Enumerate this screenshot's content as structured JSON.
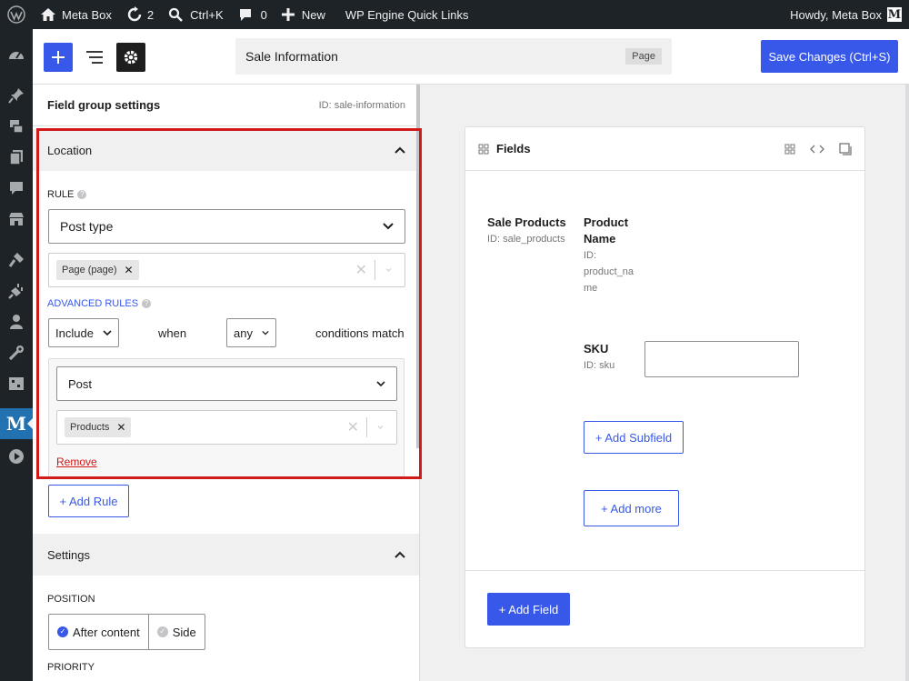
{
  "adminbar": {
    "site_name": "Meta Box",
    "updates_count": "2",
    "shortcut": "Ctrl+K",
    "comments_count": "0",
    "new_label": "New",
    "quick_links": "WP Engine Quick Links",
    "howdy": "Howdy, Meta Box",
    "avatar_letter": "M"
  },
  "adminmenu": {
    "active_letter": "M",
    "icons": [
      "dashboard-icon",
      "pin-icon",
      "media-icon",
      "pages-icon",
      "comments-icon",
      "store-icon",
      "appearance-icon",
      "plugins-icon",
      "users-icon",
      "tools-icon",
      "settings-icon",
      "metabox-icon",
      "play-icon"
    ]
  },
  "header": {
    "title": "Sale Information",
    "post_type_badge": "Page",
    "save_label": "Save Changes (Ctrl+S)"
  },
  "panel": {
    "title": "Field group settings",
    "id_text": "ID: sale-information",
    "location": {
      "heading": "Location",
      "rule_label": "RULE",
      "rule_select": "Post type",
      "rule_chip": "Page (page)",
      "advanced_label": "ADVANCED RULES",
      "include_select": "Include",
      "when_text": "when",
      "any_select": "any",
      "conditions_text": "conditions match",
      "condition_select": "Post",
      "condition_chip": "Products",
      "remove_label": "Remove",
      "add_rule_label": "+ Add Rule"
    },
    "settings": {
      "heading": "Settings",
      "position_label": "POSITION",
      "position_options": [
        "After content",
        "Side"
      ],
      "position_selected": "After content",
      "priority_label": "PRIORITY"
    }
  },
  "canvas": {
    "title": "Fields",
    "group_field": {
      "name": "Sale Products",
      "id": "ID: sale_products"
    },
    "subfields": [
      {
        "name_line1": "Product",
        "name_line2": "Name",
        "id_line1": "ID:",
        "id_line2": "product_na",
        "id_line3": "me"
      },
      {
        "name": "SKU",
        "id": "ID: sku"
      }
    ],
    "add_subfield_label": "+ Add Subfield",
    "add_more_label": "+ Add more",
    "add_field_label": "+ Add Field"
  },
  "colors": {
    "accent": "#3858e9",
    "highlight": "#d11a1a",
    "remove": "#cc1818"
  }
}
